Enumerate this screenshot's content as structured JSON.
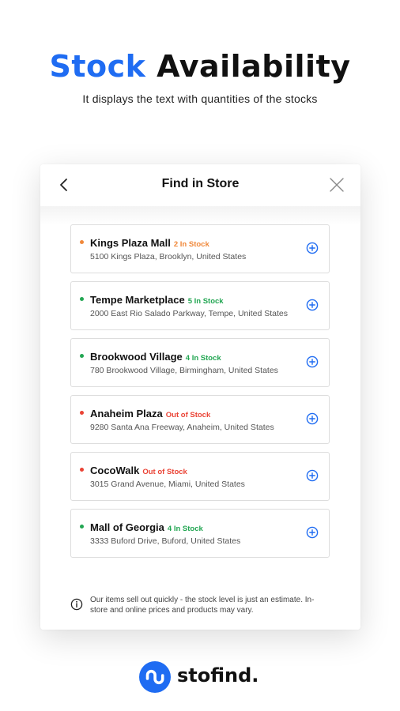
{
  "promo": {
    "headline_accent": "Stock",
    "headline_rest": "Availability",
    "subheadline": "It displays the text with quantities of the stocks"
  },
  "modal": {
    "title": "Find in Store",
    "back_icon": "chevron-left-icon",
    "close_icon": "close-icon"
  },
  "colors": {
    "accent": "#1f6cf2",
    "low_stock": "#f0883a",
    "in_stock": "#22a652",
    "out_of_stock": "#ea4335"
  },
  "stores": [
    {
      "name": "Kings Plaza Mall",
      "stock": "2 In Stock",
      "status": "low",
      "address": "5100 Kings Plaza, Brooklyn, United States"
    },
    {
      "name": "Tempe Marketplace",
      "stock": "5 In Stock",
      "status": "in",
      "address": "2000 East Rio Salado Parkway, Tempe, United States"
    },
    {
      "name": "Brookwood Village",
      "stock": "4 In Stock",
      "status": "in",
      "address": "780 Brookwood Village, Birmingham, United States"
    },
    {
      "name": "Anaheim Plaza",
      "stock": "Out of Stock",
      "status": "out",
      "address": "9280 Santa Ana Freeway, Anaheim, United States"
    },
    {
      "name": "CocoWalk",
      "stock": "Out of Stock",
      "status": "out",
      "address": "3015 Grand Avenue, Miami, United States"
    },
    {
      "name": "Mall of Georgia",
      "stock": "4 In Stock",
      "status": "in",
      "address": "3333 Buford Drive, Buford, United States"
    }
  ],
  "notice": {
    "icon": "info-icon",
    "text": "Our items sell out quickly - the stock level is just an estimate. In-store and online prices and products may vary."
  },
  "brand": {
    "name": "stofind.",
    "icon": "stofind-logo-icon"
  }
}
